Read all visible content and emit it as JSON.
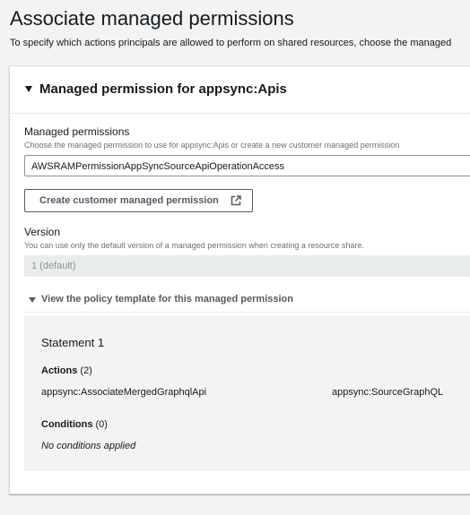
{
  "page": {
    "title": "Associate managed permissions",
    "description": "To specify which actions principals are allowed to perform on shared resources, choose the managed"
  },
  "panel": {
    "title": "Managed permission for appsync:Apis",
    "managed_permissions": {
      "label": "Managed permissions",
      "description": "Choose the managed permission to use for appsync:Apis or create a new customer managed permission",
      "selected_value": "AWSRAMPermissionAppSyncSourceApiOperationAccess"
    },
    "create_button_label": "Create customer managed permission",
    "version": {
      "label": "Version",
      "description": "You can use only the default version of a managed permission when creating a resource share.",
      "value": "1 (default)"
    },
    "policy_expander_label": "View the policy template for this managed permission",
    "policy": {
      "statement_title": "Statement 1",
      "actions_label": "Actions",
      "actions_count": "(2)",
      "actions": [
        "appsync:AssociateMergedGraphqlApi",
        "appsync:SourceGraphQL"
      ],
      "conditions_label": "Conditions",
      "conditions_count": "(0)",
      "conditions_text": "No conditions applied"
    }
  },
  "icons": {
    "panel_toggle": "caret-down-icon",
    "button_icon": "external-link-icon",
    "expander_toggle": "caret-down-icon"
  }
}
